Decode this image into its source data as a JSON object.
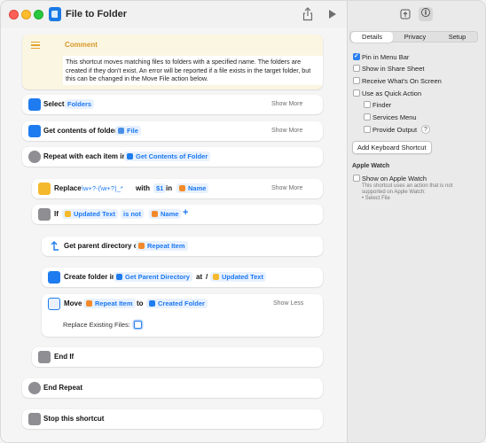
{
  "window": {
    "title": "File to Folder"
  },
  "comment": {
    "label": "Comment",
    "text": "This shortcut moves matching files to folders with a specified name. The folders are created if they don't exist. An error will be reported if a file exists in the target folder, but this can be changed in the Move File action below."
  },
  "actions": {
    "select": {
      "verb": "Select",
      "token": "Folders",
      "more": "Show More"
    },
    "get_contents": {
      "verb": "Get contents of folder",
      "token": "File",
      "more": "Show More"
    },
    "repeat": {
      "verb": "Repeat with each item in",
      "token": "Get Contents of Folder"
    },
    "replace": {
      "verb": "Replace",
      "pattern": "\\w+?-(\\w+?)_*",
      "with": "with",
      "with_token": "$1",
      "in": "in",
      "in_token": "Name",
      "more": "Show More"
    },
    "if": {
      "verb": "If",
      "token1": "Updated Text",
      "cond": "is not",
      "token2": "Name",
      "plus": "+"
    },
    "get_parent": {
      "verb": "Get parent directory of",
      "token": "Repeat Item"
    },
    "create_folder": {
      "verb": "Create folder in",
      "token1": "Get Parent Directory",
      "at": "at",
      "slash": "/",
      "token2": "Updated Text"
    },
    "move": {
      "verb": "Move",
      "token1": "Repeat Item",
      "to": "to",
      "token2": "Created Folder",
      "less": "Show Less",
      "option": "Replace Existing Files:"
    },
    "end_if": {
      "verb": "End If"
    },
    "end_repeat": {
      "verb": "End Repeat"
    },
    "stop": {
      "verb": "Stop this shortcut"
    }
  },
  "sidebar": {
    "tabs": [
      "Details",
      "Privacy",
      "Setup"
    ],
    "active_tab": "Details",
    "options": [
      {
        "label": "Pin in Menu Bar",
        "checked": true
      },
      {
        "label": "Show in Share Sheet",
        "checked": false
      },
      {
        "label": "Receive What's On Screen",
        "checked": false
      },
      {
        "label": "Use as Quick Action",
        "checked": false
      }
    ],
    "sub_options": [
      {
        "label": "Finder",
        "checked": false
      },
      {
        "label": "Services Menu",
        "checked": false
      },
      {
        "label": "Provide Output",
        "checked": false
      }
    ],
    "help_glyph": "?",
    "keyboard_button": "Add Keyboard Shortcut",
    "watch_heading": "Apple Watch",
    "watch_option": "Show on Apple Watch",
    "watch_note1": "This shortcut uses an action that is not",
    "watch_note2": "supported on Apple Watch:",
    "watch_note3": "• Select File"
  },
  "colors": {
    "accent": "#1b78f2",
    "comment": "#d8962a"
  }
}
